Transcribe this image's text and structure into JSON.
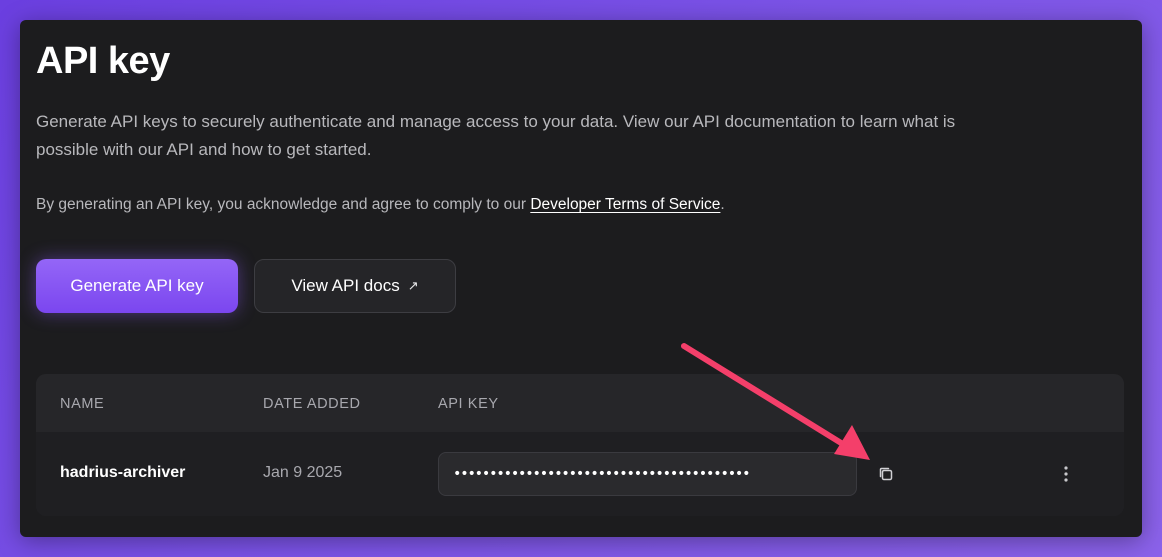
{
  "page": {
    "title": "API key",
    "description": "Generate API keys to securely authenticate and manage access to your data. View our API documentation to learn what is possible with our API and how to get started.",
    "terms_prefix": "By generating an API key, you acknowledge and agree to comply to our ",
    "terms_link": "Developer Terms of Service",
    "terms_suffix": "."
  },
  "actions": {
    "generate_label": "Generate API key",
    "docs_label": "View API docs",
    "docs_icon": "external-arrow-icon"
  },
  "table": {
    "headers": [
      "NAME",
      "DATE ADDED",
      "API KEY"
    ],
    "rows": [
      {
        "name": "hadrius-archiver",
        "date_added": "Jan 9 2025",
        "api_key_masked": "•••••••••••••••••••••••••••••••••••••••••",
        "copy_icon": "copy-icon",
        "more_icon": "more-vertical-icon"
      }
    ]
  },
  "colors": {
    "accent": "#8b5cf6",
    "background": "#6b3fe0",
    "panel": "#1c1c1e",
    "annotation_arrow": "#f43f6a"
  }
}
